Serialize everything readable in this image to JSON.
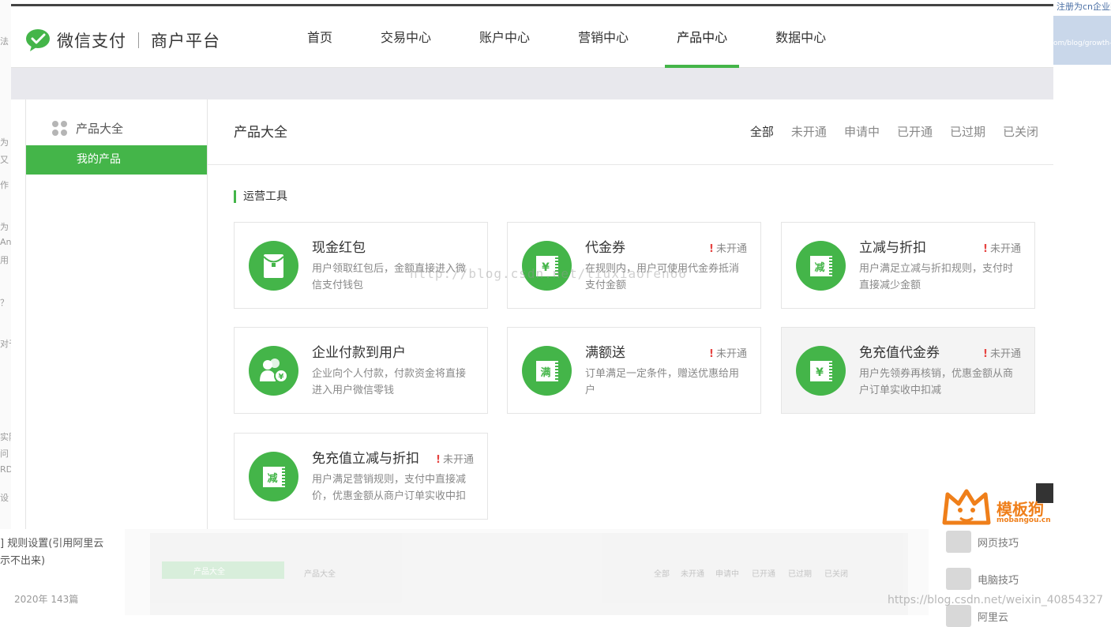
{
  "background": {
    "left_fragments": [
      "法",
      "为",
      "又",
      "作",
      "为",
      "An",
      "用",
      "？",
      "对于",
      "实际",
      "问",
      "RD",
      "设"
    ],
    "right_top_text": "注册为cn企业账户",
    "right_thumb_text": "om/blog/growth-",
    "bottom_left_lines": [
      "] 规则设置(引用阿里云",
      "示不出来)"
    ],
    "bottom_left_meta": "2020年  143篇",
    "mini_side_label": "产品大全",
    "mini_title": "产品大全",
    "mini_filters": [
      "全部",
      "未开通",
      "申请中",
      "已开通",
      "已过期",
      "已关闭"
    ],
    "right_items": [
      "网页技巧",
      "电脑技巧",
      "阿里云"
    ],
    "csdn_url": "https://blog.csdn.net/weixin_40854327"
  },
  "header": {
    "brand": "微信支付",
    "sub": "商户平台",
    "nav": [
      {
        "label": "首页",
        "active": false
      },
      {
        "label": "交易中心",
        "active": false
      },
      {
        "label": "账户中心",
        "active": false
      },
      {
        "label": "营销中心",
        "active": false
      },
      {
        "label": "产品中心",
        "active": true
      },
      {
        "label": "数据中心",
        "active": false
      }
    ]
  },
  "sidebar": {
    "heading": "产品大全",
    "items": [
      {
        "label": "我的产品",
        "active": true
      }
    ]
  },
  "main": {
    "title": "产品大全",
    "filters": [
      {
        "label": "全部",
        "active": true
      },
      {
        "label": "未开通",
        "active": false
      },
      {
        "label": "申请中",
        "active": false
      },
      {
        "label": "已开通",
        "active": false
      },
      {
        "label": "已过期",
        "active": false
      },
      {
        "label": "已关闭",
        "active": false
      }
    ],
    "section": "运营工具",
    "products": [
      {
        "name": "现金红包",
        "status": "",
        "desc": "用户领取红包后，金额直接进入微信支付钱包",
        "icon": "red-packet-icon",
        "glyph": ""
      },
      {
        "name": "代金券",
        "status": "未开通",
        "desc": "在规则内，用户可使用代金券抵消支付金额",
        "icon": "voucher-icon",
        "glyph": "¥"
      },
      {
        "name": "立减与折扣",
        "status": "未开通",
        "desc": "用户满足立减与折扣规则，支付时直接减少金额",
        "icon": "discount-icon",
        "glyph": "减"
      },
      {
        "name": "企业付款到用户",
        "status": "",
        "desc": "企业向个人付款，付款资金将直接进入用户微信零钱",
        "icon": "enterprise-pay-icon",
        "glyph": "¥"
      },
      {
        "name": "满额送",
        "status": "未开通",
        "desc": "订单满足一定条件，赠送优惠给用户",
        "icon": "full-gift-icon",
        "glyph": "满"
      },
      {
        "name": "免充值代金券",
        "status": "未开通",
        "desc": "用户先领券再核销，优惠金额从商户订单实收中扣减",
        "icon": "free-voucher-icon",
        "glyph": "¥"
      },
      {
        "name": "免充值立减与折扣",
        "status": "未开通",
        "desc": "用户满足营销规则，支付中直接减价，优惠金额从商户订单实收中扣",
        "icon": "free-discount-icon",
        "glyph": "减"
      }
    ]
  },
  "watermark": "http://blog.csdn.net/liuxiaoren66",
  "mobangou": {
    "title": "模板狗",
    "url": "mobangou.cn"
  },
  "colors": {
    "accent": "#44b549",
    "alert": "#e64340",
    "mobangou": "#ef7f1a"
  }
}
